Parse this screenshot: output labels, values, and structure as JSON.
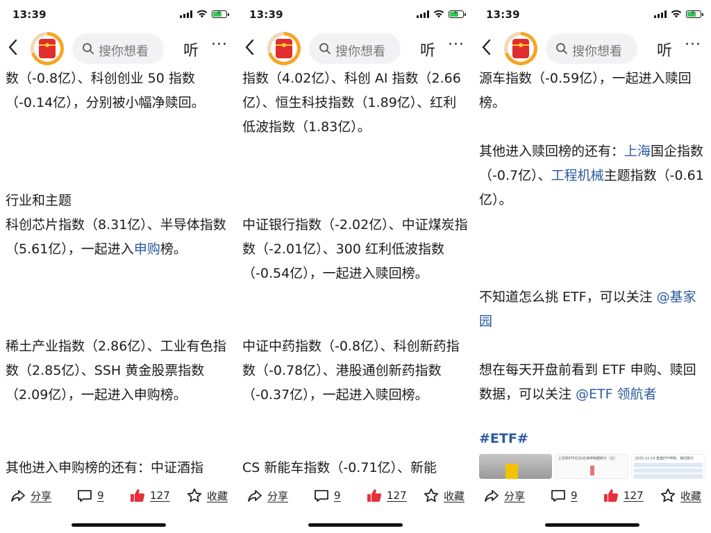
{
  "screens": [
    {
      "status_time": "13:39",
      "search_placeholder": "搜你想看",
      "listen_label": "听",
      "more_label": "···",
      "paragraphs": [
        {
          "parts": [
            {
              "text": "数（-0.8亿）、科创创业 50 指数（-0.14亿），分别被小幅净赎回。"
            }
          ]
        },
        {
          "parts": [
            {
              "text": "行业和主题"
            }
          ]
        },
        {
          "parts": [
            {
              "text": "科创芯片指数（8.31亿）、半导体指数（5.61亿），一起进入"
            },
            {
              "text": "申购",
              "link": true
            },
            {
              "text": "榜。"
            }
          ]
        },
        {
          "parts": [
            {
              "text": "稀土产业指数（2.86亿）、工业有色指数（2.85亿）、SSH 黄金股票指数（2.09亿），一起进入申购榜。"
            }
          ]
        },
        {
          "parts": [
            {
              "text": "其他进入申购榜的还有：中证酒指"
            }
          ]
        }
      ]
    },
    {
      "status_time": "13:39",
      "search_placeholder": "搜你想看",
      "listen_label": "听",
      "more_label": "···",
      "paragraphs": [
        {
          "parts": [
            {
              "text": "指数（4.02亿）、科创 AI 指数（2.66亿）、恒生科技指数（1.89亿）、红利低波指数（1.83亿）。"
            }
          ]
        },
        {
          "parts": [
            {
              "text": "中证银行指数（-2.02亿）、中证煤炭指数（-2.01亿）、300 红利低波指数（-0.54亿），一起进入赎回榜。"
            }
          ]
        },
        {
          "parts": [
            {
              "text": "中证中药指数（-0.8亿）、科创新药指数（-0.78亿）、港股通创新药指数（-0.37亿），一起进入赎回榜。"
            }
          ]
        },
        {
          "parts": [
            {
              "text": "CS 新能车指数（-0.71亿）、新能"
            }
          ]
        }
      ]
    },
    {
      "status_time": "13:39",
      "search_placeholder": "搜你想看",
      "listen_label": "听",
      "more_label": "···",
      "paragraphs": [
        {
          "parts": [
            {
              "text": "源车指数（-0.59亿），一起进入赎回榜。"
            }
          ]
        },
        {
          "parts": [
            {
              "text": "其他进入赎回榜的还有："
            },
            {
              "text": "上海",
              "link": true
            },
            {
              "text": "国企指数（-0.7亿）、"
            },
            {
              "text": "工程机械",
              "link": true
            },
            {
              "text": "主题指数（-0.61亿）。"
            }
          ]
        },
        {
          "parts": [
            {
              "text": "不知道怎么挑 ETF，可以关注 "
            },
            {
              "text": "@基家园",
              "link": true
            }
          ]
        },
        {
          "parts": [
            {
              "text": "想在每天开盘前看到 ETF 申购、赎回数据，可以关注 "
            },
            {
              "text": "@ETF 领航者",
              "link": true
            }
          ]
        }
      ],
      "hashtag": "#ETF#",
      "thumb_titles": [
        "上交所ETF近30日净申赎额统计（亿）",
        "2025-11-14 宽基ETF申购、赎回统计"
      ]
    }
  ],
  "actions": {
    "share": "分享",
    "comments": "9",
    "likes": "127",
    "favorite": "收藏"
  },
  "colors": {
    "link": "#2b5a9e",
    "like": "#e8303a",
    "battery": "#34c759"
  },
  "icons": [
    "back-icon",
    "avatar-redbag-icon",
    "search-icon",
    "listen-icon",
    "more-icon",
    "share-icon",
    "comment-icon",
    "like-icon",
    "star-icon"
  ]
}
